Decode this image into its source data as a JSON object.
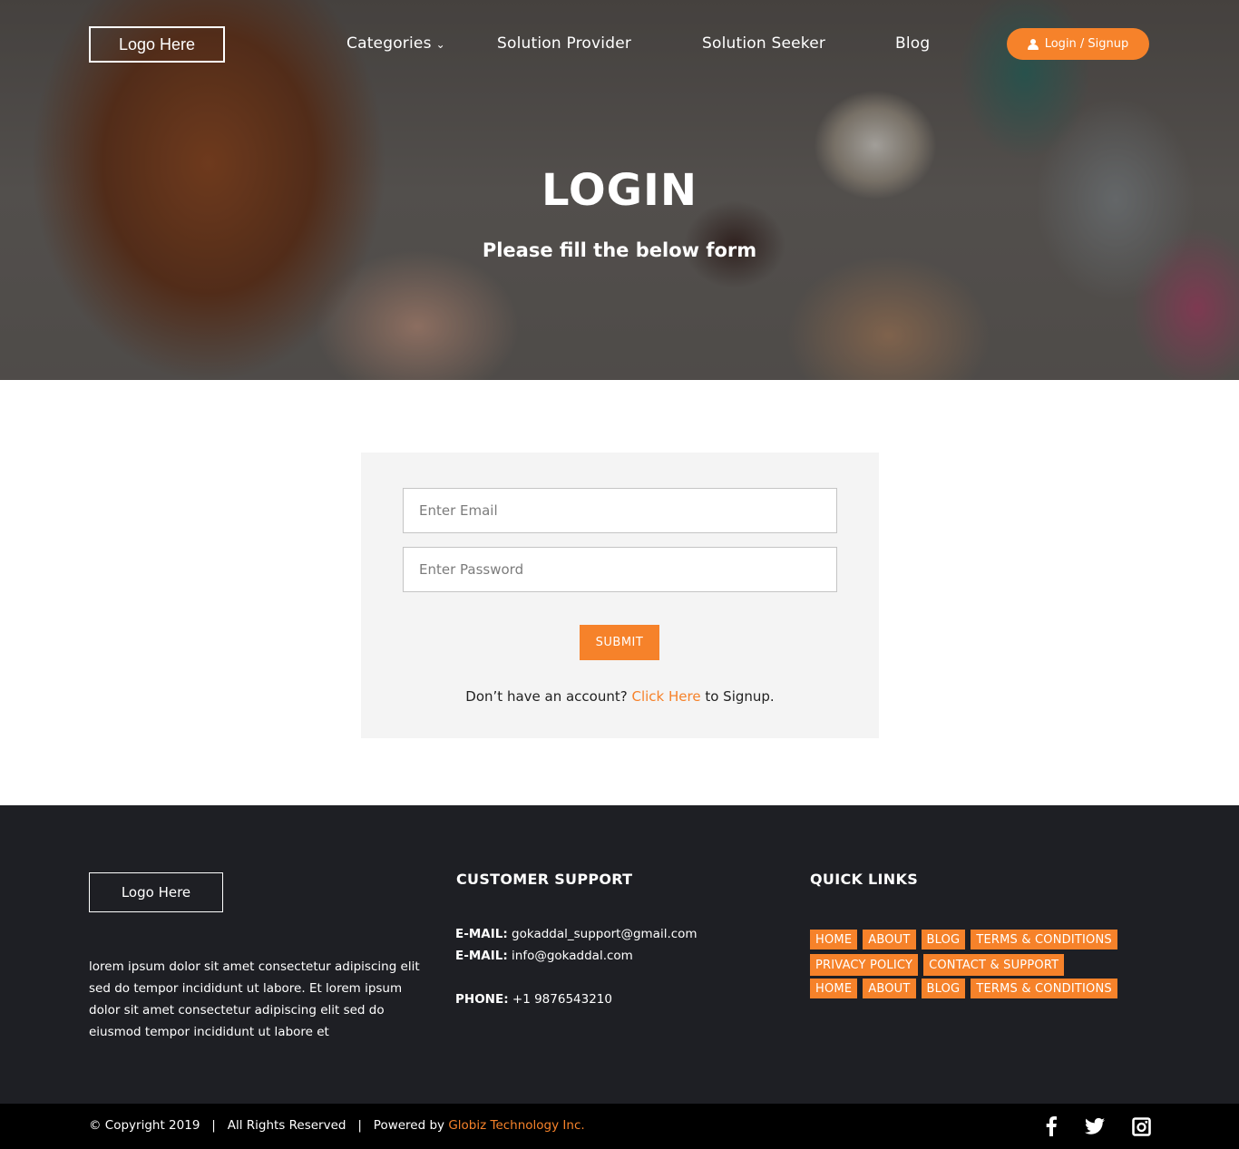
{
  "header": {
    "logo": "Logo Here",
    "nav": [
      {
        "label": "Categories",
        "has_dropdown": true
      },
      {
        "label": "Solution Provider"
      },
      {
        "label": "Solution Seeker"
      },
      {
        "label": "Blog"
      }
    ],
    "login_signup_label": "Login / Signup",
    "accent_color": "#f6822a"
  },
  "hero": {
    "title": "LOGIN",
    "subtitle": "Please fill the below form"
  },
  "form": {
    "email_placeholder": "Enter Email",
    "password_placeholder": "Enter Password",
    "submit_label": "SUBMIT",
    "signup_prefix": "Don’t have an account? ",
    "signup_link": "Click Here",
    "signup_suffix": " to Signup."
  },
  "footer": {
    "logo": "Logo Here",
    "about": "lorem ipsum dolor sit amet consectetur adipiscing elit sed do tempor incididunt ut labore.  Et lorem ipsum dolor sit amet consectetur adipiscing elit sed do eiusmod tempor incididunt ut labore et",
    "support": {
      "heading": "CUSTOMER SUPPORT",
      "email_label": "E-MAIL:",
      "email1": "gokaddal_support@gmail.com",
      "email2": "info@gokaddal.com",
      "phone_label": "PHONE:",
      "phone": "+1 9876543210"
    },
    "quick_links": {
      "heading": "QUICK LINKS",
      "rows": [
        [
          "HOME",
          "ABOUT",
          "BLOG",
          "TERMS & CONDITIONS"
        ],
        [
          "PRIVACY POLICY",
          "CONTACT & SUPPORT"
        ],
        [
          "HOME",
          "ABOUT",
          "BLOG",
          "TERMS & CONDITIONS"
        ]
      ]
    }
  },
  "bottom_bar": {
    "copyright": "© Copyright 2019",
    "separator": "|",
    "rights": "All Rights Reserved",
    "powered_by": "Powered by ",
    "company": "Globiz Technology Inc.",
    "social_icons": [
      "facebook-icon",
      "twitter-icon",
      "instagram-icon"
    ]
  }
}
